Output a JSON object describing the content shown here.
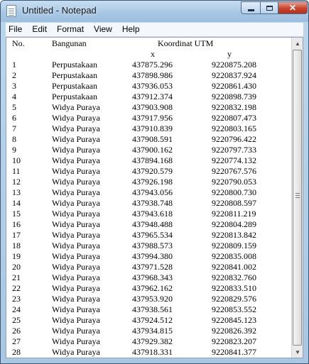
{
  "window": {
    "title": "Untitled - Notepad"
  },
  "menu": {
    "items": [
      "File",
      "Edit",
      "Format",
      "View",
      "Help"
    ]
  },
  "document": {
    "header": {
      "no": "No.",
      "bangunan": "Bangunan",
      "koordinat": "Koordinat UTM",
      "x": "x",
      "y": "y"
    },
    "rows": [
      [
        "1",
        "Perpustakaan",
        "437875.296",
        "9220875.208"
      ],
      [
        "2",
        "Perpustakaan",
        "437898.986",
        "9220837.924"
      ],
      [
        "3",
        "Perpustakaan",
        "437936.053",
        "9220861.430"
      ],
      [
        "4",
        "Perpustakaan",
        "437912.374",
        "9220898.739"
      ],
      [
        "5",
        "Widya Puraya",
        "437903.908",
        "9220832.198"
      ],
      [
        "6",
        "Widya Puraya",
        "437917.956",
        "9220807.473"
      ],
      [
        "7",
        "Widya Puraya",
        "437910.839",
        "9220803.165"
      ],
      [
        "8",
        "Widya Puraya",
        "437908.591",
        "9220796.422"
      ],
      [
        "9",
        "Widya Puraya",
        "437900.162",
        "9220797.733"
      ],
      [
        "10",
        "Widya Puraya",
        "437894.168",
        "9220774.132"
      ],
      [
        "11",
        "Widya Puraya",
        "437920.579",
        "9220767.576"
      ],
      [
        "12",
        "Widya Puraya",
        "437926.198",
        "9220790.053"
      ],
      [
        "13",
        "Widya Puraya",
        "437943.056",
        "9220800.730"
      ],
      [
        "14",
        "Widya Puraya",
        "437938.748",
        "9220808.597"
      ],
      [
        "15",
        "Widya Puraya",
        "437943.618",
        "9220811.219"
      ],
      [
        "16",
        "Widya Puraya",
        "437948.488",
        "9220804.289"
      ],
      [
        "17",
        "Widya Puraya",
        "437965.534",
        "9220813.842"
      ],
      [
        "18",
        "Widya Puraya",
        "437988.573",
        "9220809.159"
      ],
      [
        "19",
        "Widya Puraya",
        "437994.380",
        "9220835.008"
      ],
      [
        "20",
        "Widya Puraya",
        "437971.528",
        "9220841.002"
      ],
      [
        "21",
        "Widya Puraya",
        "437968.343",
        "9220832.760"
      ],
      [
        "22",
        "Widya Puraya",
        "437962.162",
        "9220833.510"
      ],
      [
        "23",
        "Widya Puraya",
        "437953.920",
        "9220829.576"
      ],
      [
        "24",
        "Widya Puraya",
        "437938.561",
        "9220853.552"
      ],
      [
        "25",
        "Widya Puraya",
        "437924.512",
        "9220845.123"
      ],
      [
        "26",
        "Widya Puraya",
        "437934.815",
        "9220826.392"
      ],
      [
        "27",
        "Widya Puraya",
        "437929.382",
        "9220823.207"
      ],
      [
        "28",
        "Widya Puraya",
        "437918.331",
        "9220841.377"
      ]
    ]
  },
  "icons": {
    "app": "notepad-icon",
    "minimize": "minimize-icon",
    "maximize": "maximize-icon",
    "close": "close-icon",
    "scroll_up": "scroll-up-arrow-icon",
    "scroll_down": "scroll-down-arrow-icon"
  },
  "colors": {
    "close_button": "#c7442c",
    "title_bar": "#a8c7e4"
  }
}
